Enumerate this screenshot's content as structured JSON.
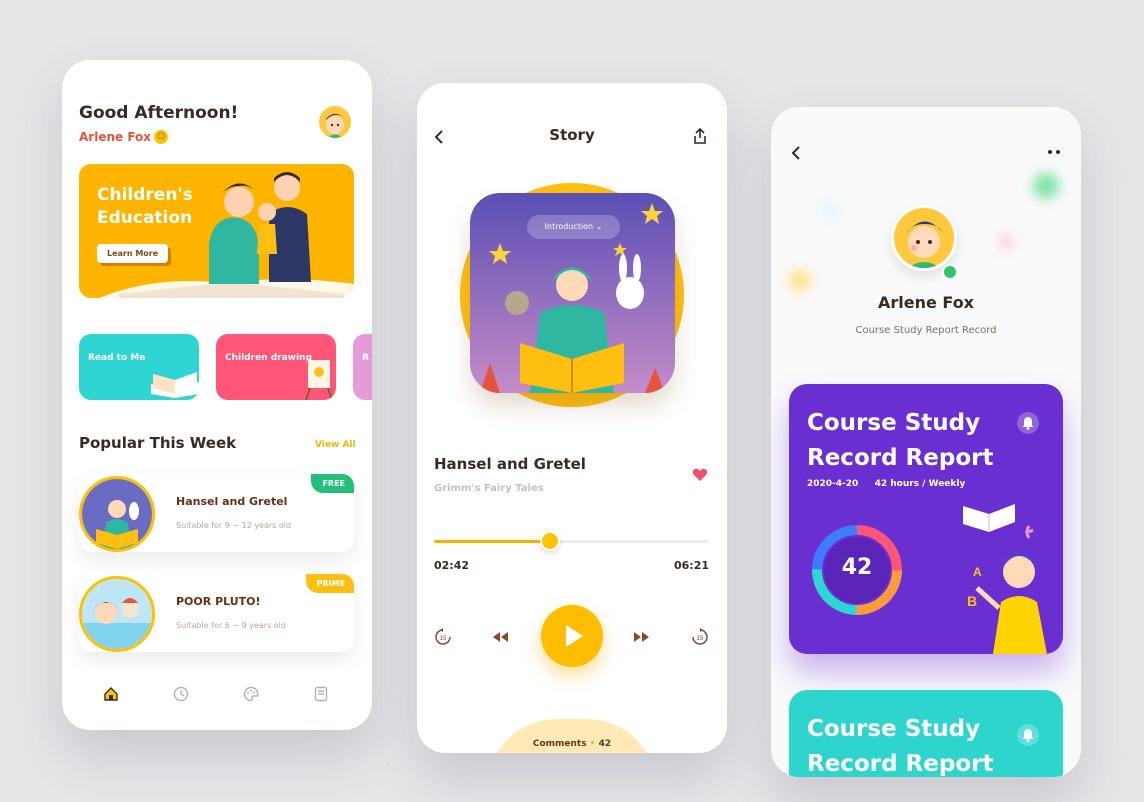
{
  "home": {
    "greeting": "Good Afternoon!",
    "user_name": "Arlene Fox",
    "hero_title": "Children's Education",
    "hero_button": "Learn More",
    "categories": [
      {
        "label": "Read to Me",
        "color": "#2fd5d3"
      },
      {
        "label": "Children drawing",
        "color": "#ff5577"
      },
      {
        "label": "R",
        "color": "#e59bd5"
      }
    ],
    "section_title": "Popular This Week",
    "view_all": "View All",
    "cards": [
      {
        "title": "Hansel and Gretel",
        "subtitle": "Suitable for 9 ~ 12 years old",
        "badge": "FREE",
        "badge_color": "#22c07a"
      },
      {
        "title": "POOR PLUTO!",
        "subtitle": "Suitable for 6 ~ 9 years old",
        "badge": "PRIME",
        "badge_color": "#ffbf10"
      }
    ],
    "nav": [
      "home-icon",
      "clock-icon",
      "palette-icon",
      "book-icon"
    ]
  },
  "player": {
    "title": "Story",
    "intro_label": "Introduction",
    "track_title": "Hansel and Gretel",
    "track_subtitle": "Grimm's Fairy Tales",
    "current_time": "02:42",
    "total_time": "06:21",
    "progress": 0.42,
    "comments_label": "Comments",
    "comments_count": "42",
    "accent": "#ffbd00"
  },
  "profile": {
    "name": "Arlene Fox",
    "subtitle": "Course Study Report Record",
    "report_title": "Course Study Record Report",
    "report_date": "2020-4-20",
    "report_hours": "42 hours / Weekly",
    "report_value": "42",
    "report_color": "#6a2fd1",
    "report2_title": "Course Study Record Report",
    "report2_color": "#2dd5cc"
  }
}
